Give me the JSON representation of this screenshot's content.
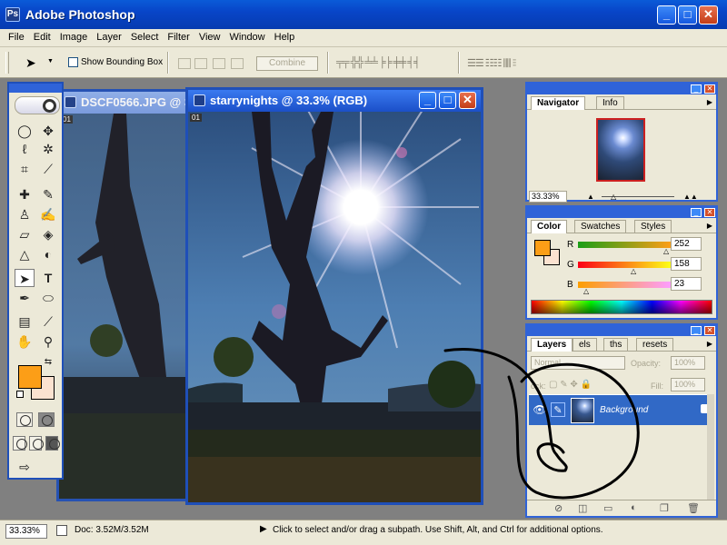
{
  "window": {
    "title": "Adobe Photoshop",
    "app_icon": "photoshop-icon",
    "minimize": "_",
    "maximize": "□",
    "close": "✕"
  },
  "menu": [
    "File",
    "Edit",
    "Image",
    "Layer",
    "Select",
    "Filter",
    "View",
    "Window",
    "Help"
  ],
  "options_bar": {
    "show_bounding_box": "Show Bounding Box",
    "show_bounding_box_checked": false,
    "combine": "Combine"
  },
  "documents": {
    "back": {
      "title": "DSCF0566.JPG @ 3",
      "page": "01"
    },
    "front": {
      "title": "starrynights @ 33.3% (RGB)",
      "page": "01"
    }
  },
  "navigator": {
    "tabs": [
      "Navigator",
      "Info"
    ],
    "zoom": "33.33%"
  },
  "color": {
    "tabs": [
      "Color",
      "Swatches",
      "Styles"
    ],
    "channels": [
      {
        "label": "R",
        "value": "252"
      },
      {
        "label": "G",
        "value": "158"
      },
      {
        "label": "B",
        "value": "23"
      }
    ],
    "foreground_hex": "#fc9e17",
    "background_hex": "#fbe2d0"
  },
  "layers": {
    "tabs": [
      "Layers",
      "els",
      "ths",
      "resets"
    ],
    "blend_mode": "Normal",
    "opacity_label": "Opacity:",
    "opacity_value": "100%",
    "lock_label": "ock:",
    "fill_label": "Fill:",
    "fill_value": "100%",
    "layer_name": "Background"
  },
  "status": {
    "zoom": "33.33%",
    "doc": "Doc: 3.52M/3.52M",
    "hint": "Click to select and/or drag a subpath.  Use Shift, Alt, and Ctrl for additional options."
  },
  "accent": "#2f63d8"
}
